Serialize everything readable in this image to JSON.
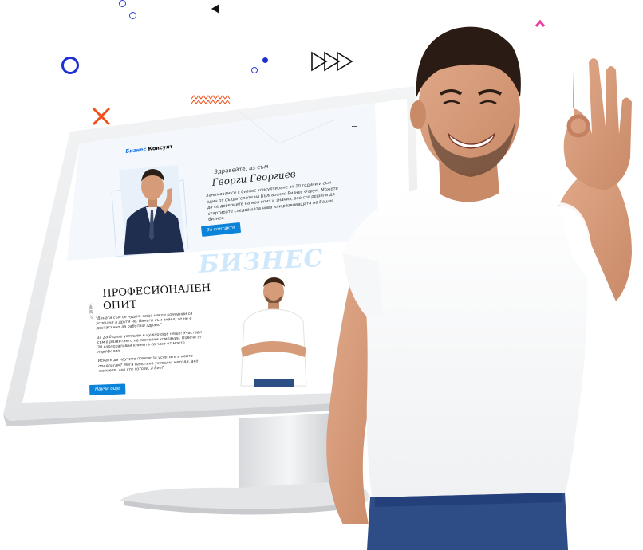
{
  "brand": {
    "part1": "Бизнес",
    "part2": "Консулт"
  },
  "hero": {
    "greeting": "Здравейте, аз съм",
    "name": "Георги Георгиев",
    "description": "Занимавам се с бизнес консултиране от 10 години и съм един от създателите на Българския Бизнес Форум. Можете да се довериите на моя опит и знания, ако сте решили да стартирате следващата нова или развиващата на Вашия бизнес.",
    "contact_button": "За контакти"
  },
  "section": {
    "background_word": "БИЗНЕС",
    "title": "ПРОФЕСИОНАЛЕН ОПИТ",
    "side_label": "от 2010г.",
    "paragraph_1": "\"Винаги съм се чудил, защо някои компании са успешни а други не. Винаги съм знаел, че не е достатъчно да работиш здраво\"",
    "paragraph_2": "За да бъдеш успешен е нужно още нещо! Участвал съм в развитието на световни компании. Повече от 30 корпоративни клиента са част от моето портфолио.",
    "paragraph_3": "Искате да научите повече за услугите и които предлагам? Мога наистина успешни методи, ако желаете, ако сте готови, а Вие?",
    "learn_more_button": "Научи още"
  },
  "colors": {
    "accent": "#0b83d9",
    "decor_blue": "#1d2fd3",
    "decor_orange": "#f0521d",
    "decor_pink": "#e83ea5"
  }
}
